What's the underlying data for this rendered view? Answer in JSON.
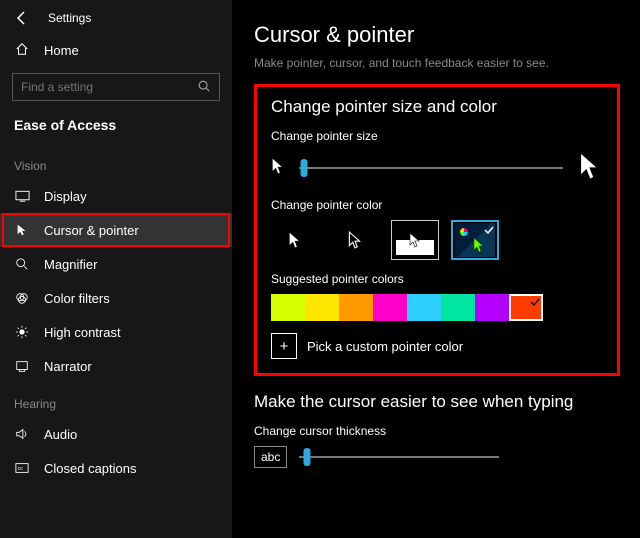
{
  "window_title": "Settings",
  "home_label": "Home",
  "search_placeholder": "Find a setting",
  "category_title": "Ease of Access",
  "groups": {
    "vision": {
      "label": "Vision"
    },
    "hearing": {
      "label": "Hearing"
    }
  },
  "nav": {
    "display": "Display",
    "cursor_pointer": "Cursor & pointer",
    "magnifier": "Magnifier",
    "color_filters": "Color filters",
    "high_contrast": "High contrast",
    "narrator": "Narrator",
    "audio": "Audio",
    "closed_captions": "Closed captions"
  },
  "page": {
    "title": "Cursor & pointer",
    "subtitle": "Make pointer, cursor, and touch feedback easier to see."
  },
  "section_size_color": {
    "heading": "Change pointer size and color",
    "size_label": "Change pointer size",
    "color_label": "Change pointer color",
    "suggested_label": "Suggested pointer colors",
    "custom_label": "Pick a custom pointer color"
  },
  "swatches": [
    "#d6ff00",
    "#ffe600",
    "#ff9900",
    "#ff00c8",
    "#2ecfff",
    "#00e5a0",
    "#b400ff",
    "#ff3c00"
  ],
  "swatch_selected_index": 7,
  "section_cursor": {
    "heading": "Make the cursor easier to see when typing",
    "thickness_label": "Change cursor thickness",
    "abc_sample": "abc"
  }
}
